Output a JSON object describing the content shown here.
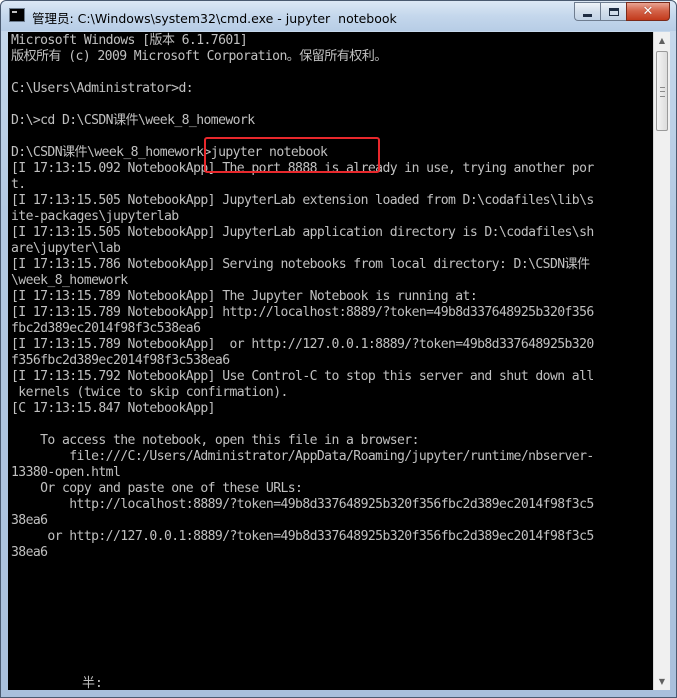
{
  "window": {
    "title": "管理员: C:\\Windows\\system32\\cmd.exe - jupyter  notebook"
  },
  "caption_buttons": {
    "minimize": "minimize-icon",
    "maximize": "maximize-icon",
    "close": "close-icon",
    "close_glyph": "✕"
  },
  "console": {
    "lines": [
      "Microsoft Windows [版本 6.1.7601]",
      "版权所有 (c) 2009 Microsoft Corporation。保留所有权利。",
      "",
      "C:\\Users\\Administrator>d:",
      "",
      "D:\\>cd D:\\CSDN课件\\week_8_homework",
      "",
      "D:\\CSDN课件\\week_8_homework>jupyter notebook",
      "[I 17:13:15.092 NotebookApp] The port 8888 is already in use, trying another por",
      "t.",
      "[I 17:13:15.505 NotebookApp] JupyterLab extension loaded from D:\\codafiles\\lib\\s",
      "ite-packages\\jupyterlab",
      "[I 17:13:15.505 NotebookApp] JupyterLab application directory is D:\\codafiles\\sh",
      "are\\jupyter\\lab",
      "[I 17:13:15.786 NotebookApp] Serving notebooks from local directory: D:\\CSDN课件",
      "\\week_8_homework",
      "[I 17:13:15.789 NotebookApp] The Jupyter Notebook is running at:",
      "[I 17:13:15.789 NotebookApp] http://localhost:8889/?token=49b8d337648925b320f356",
      "fbc2d389ec2014f98f3c538ea6",
      "[I 17:13:15.789 NotebookApp]  or http://127.0.0.1:8889/?token=49b8d337648925b320",
      "f356fbc2d389ec2014f98f3c538ea6",
      "[I 17:13:15.792 NotebookApp] Use Control-C to stop this server and shut down all",
      " kernels (twice to skip confirmation).",
      "[C 17:13:15.847 NotebookApp]",
      "",
      "    To access the notebook, open this file in a browser:",
      "        file:///C:/Users/Administrator/AppData/Roaming/jupyter/runtime/nbserver-",
      "13380-open.html",
      "    Or copy and paste one of these URLs:",
      "        http://localhost:8889/?token=49b8d337648925b320f356fbc2d389ec2014f98f3c5",
      "38ea6",
      "     or http://127.0.0.1:8889/?token=49b8d337648925b320f356fbc2d389ec2014f98f3c5",
      "38ea6"
    ],
    "ime_status": "半:"
  },
  "colors": {
    "console_bg": "#000000",
    "console_fg": "#c0c0c0",
    "highlight": "#e8282c"
  }
}
